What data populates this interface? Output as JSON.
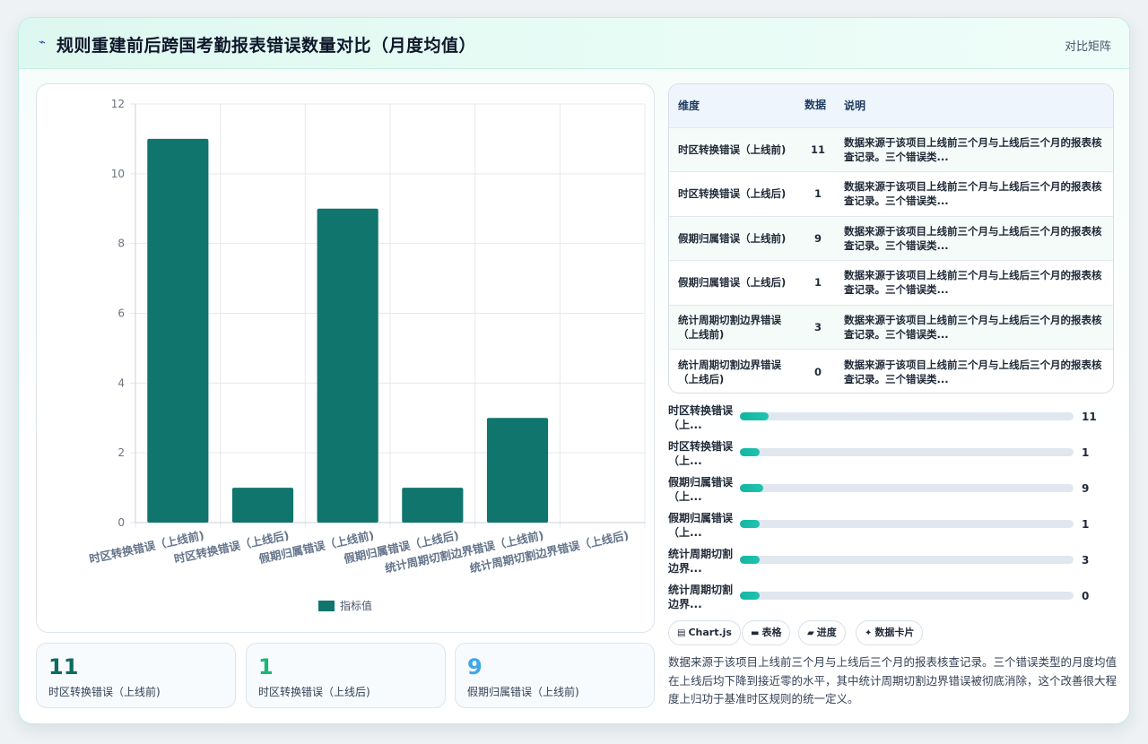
{
  "header": {
    "logo_icon": "chart-trend-icon",
    "title": "规则重建前后跨国考勤报表错误数量对比（月度均值）",
    "tag": "对比矩阵"
  },
  "colors": {
    "bar": "#10756d",
    "progress": "#13b5a0",
    "stat_primary": "#0c6b62",
    "stat_green": "#17b877",
    "stat_blue": "#3da7e8"
  },
  "chart_data": {
    "type": "bar",
    "categories": [
      "时区转换错误（上线前)",
      "时区转换错误（上线后)",
      "假期归属错误（上线前)",
      "假期归属错误（上线后)",
      "统计周期切割边界错误（上线前)",
      "统计周期切割边界错误（上线后)"
    ],
    "series": [
      {
        "name": "指标值",
        "values": [
          11,
          1,
          9,
          1,
          3,
          0
        ]
      }
    ],
    "ylim": [
      0,
      12
    ],
    "yticks": [
      0,
      2,
      4,
      6,
      8,
      10,
      12
    ],
    "grid": true,
    "legend": "bottom"
  },
  "stats": [
    {
      "value": "11",
      "label": "时区转换错误（上线前)"
    },
    {
      "value": "1",
      "label": "时区转换错误（上线后)"
    },
    {
      "value": "9",
      "label": "假期归属错误（上线前)"
    }
  ],
  "table": {
    "headers": [
      "维度",
      "数据",
      "说明"
    ],
    "rows": [
      {
        "dim": "时区转换错误（上线前)",
        "value": "11",
        "desc": "数据来源于该项目上线前三个月与上线后三个月的报表核查记录。三个错误类..."
      },
      {
        "dim": "时区转换错误（上线后)",
        "value": "1",
        "desc": "数据来源于该项目上线前三个月与上线后三个月的报表核查记录。三个错误类..."
      },
      {
        "dim": "假期归属错误（上线前)",
        "value": "9",
        "desc": "数据来源于该项目上线前三个月与上线后三个月的报表核查记录。三个错误类..."
      },
      {
        "dim": "假期归属错误（上线后)",
        "value": "1",
        "desc": "数据来源于该项目上线前三个月与上线后三个月的报表核查记录。三个错误类..."
      },
      {
        "dim": "统计周期切割边界错误（上线前)",
        "value": "3",
        "desc": "数据来源于该项目上线前三个月与上线后三个月的报表核查记录。三个错误类..."
      },
      {
        "dim": "统计周期切割边界错误（上线后)",
        "value": "0",
        "desc": "数据来源于该项目上线前三个月与上线后三个月的报表核查记录。三个错误类..."
      }
    ]
  },
  "progress": [
    {
      "label": "时区转换错误（上...",
      "value": "11",
      "fraction": 0.085
    },
    {
      "label": "时区转换错误（上...",
      "value": "1",
      "fraction": 0.06
    },
    {
      "label": "假期归属错误（上...",
      "value": "9",
      "fraction": 0.07
    },
    {
      "label": "假期归属错误（上...",
      "value": "1",
      "fraction": 0.06
    },
    {
      "label": "统计周期切割边界...",
      "value": "3",
      "fraction": 0.06
    },
    {
      "label": "统计周期切割边界...",
      "value": "0",
      "fraction": 0.06
    }
  ],
  "chips": [
    {
      "icon": "window-icon",
      "glyph": "▤",
      "label": "Chart.js"
    },
    {
      "icon": "table-icon",
      "glyph": "▬",
      "label": "表格"
    },
    {
      "icon": "progress-icon",
      "glyph": "▰",
      "label": "进度"
    },
    {
      "icon": "sparkle-icon",
      "glyph": "✦",
      "label": "数据卡片"
    }
  ],
  "note": "数据来源于该项目上线前三个月与上线后三个月的报表核查记录。三个错误类型的月度均值在上线后均下降到接近零的水平，其中统计周期切割边界错误被彻底消除，这个改善很大程度上归功于基准时区规则的统一定义。"
}
